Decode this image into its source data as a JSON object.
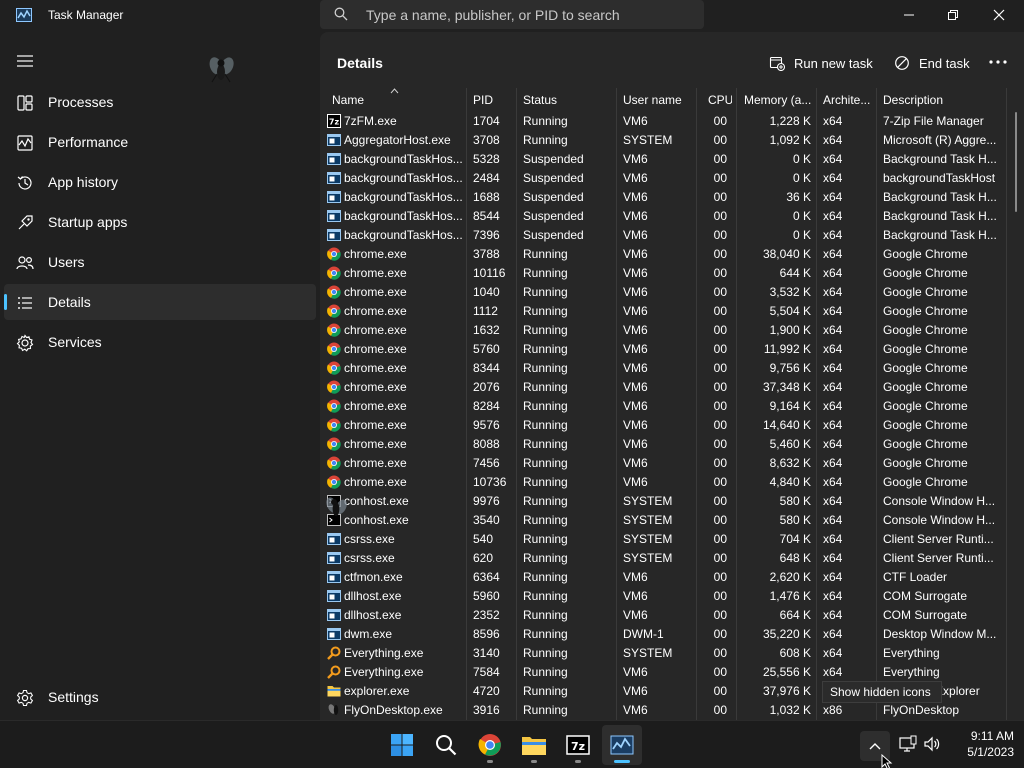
{
  "window": {
    "title": "Task Manager",
    "search_placeholder": "Type a name, publisher, or PID to search"
  },
  "sidebar": {
    "items": [
      {
        "label": "Processes",
        "icon": "processes-icon",
        "active": false
      },
      {
        "label": "Performance",
        "icon": "performance-icon",
        "active": false
      },
      {
        "label": "App history",
        "icon": "app-history-icon",
        "active": false
      },
      {
        "label": "Startup apps",
        "icon": "startup-apps-icon",
        "active": false
      },
      {
        "label": "Users",
        "icon": "users-icon",
        "active": false
      },
      {
        "label": "Details",
        "icon": "details-icon",
        "active": true
      },
      {
        "label": "Services",
        "icon": "services-icon",
        "active": false
      }
    ],
    "settings_label": "Settings"
  },
  "main": {
    "title": "Details",
    "run_new_task_label": "Run new task",
    "end_task_label": "End task"
  },
  "table": {
    "columns": [
      "Name",
      "PID",
      "Status",
      "User name",
      "CPU",
      "Memory (a...",
      "Archite...",
      "Description"
    ],
    "rows": [
      {
        "icon": "7zip",
        "name": "7zFM.exe",
        "pid": "1704",
        "status": "Running",
        "user": "VM6",
        "cpu": "00",
        "memory": "1,228 K",
        "arch": "x64",
        "desc": "7-Zip File Manager"
      },
      {
        "icon": "app",
        "name": "AggregatorHost.exe",
        "pid": "3708",
        "status": "Running",
        "user": "SYSTEM",
        "cpu": "00",
        "memory": "1,092 K",
        "arch": "x64",
        "desc": "Microsoft (R) Aggre..."
      },
      {
        "icon": "app",
        "name": "backgroundTaskHos...",
        "pid": "5328",
        "status": "Suspended",
        "user": "VM6",
        "cpu": "00",
        "memory": "0 K",
        "arch": "x64",
        "desc": "Background Task H..."
      },
      {
        "icon": "app",
        "name": "backgroundTaskHos...",
        "pid": "2484",
        "status": "Suspended",
        "user": "VM6",
        "cpu": "00",
        "memory": "0 K",
        "arch": "x64",
        "desc": "backgroundTaskHost"
      },
      {
        "icon": "app",
        "name": "backgroundTaskHos...",
        "pid": "1688",
        "status": "Suspended",
        "user": "VM6",
        "cpu": "00",
        "memory": "36 K",
        "arch": "x64",
        "desc": "Background Task H..."
      },
      {
        "icon": "app",
        "name": "backgroundTaskHos...",
        "pid": "8544",
        "status": "Suspended",
        "user": "VM6",
        "cpu": "00",
        "memory": "0 K",
        "arch": "x64",
        "desc": "Background Task H..."
      },
      {
        "icon": "app",
        "name": "backgroundTaskHos...",
        "pid": "7396",
        "status": "Suspended",
        "user": "VM6",
        "cpu": "00",
        "memory": "0 K",
        "arch": "x64",
        "desc": "Background Task H..."
      },
      {
        "icon": "chrome",
        "name": "chrome.exe",
        "pid": "3788",
        "status": "Running",
        "user": "VM6",
        "cpu": "00",
        "memory": "38,040 K",
        "arch": "x64",
        "desc": "Google Chrome"
      },
      {
        "icon": "chrome",
        "name": "chrome.exe",
        "pid": "10116",
        "status": "Running",
        "user": "VM6",
        "cpu": "00",
        "memory": "644 K",
        "arch": "x64",
        "desc": "Google Chrome"
      },
      {
        "icon": "chrome",
        "name": "chrome.exe",
        "pid": "1040",
        "status": "Running",
        "user": "VM6",
        "cpu": "00",
        "memory": "3,532 K",
        "arch": "x64",
        "desc": "Google Chrome"
      },
      {
        "icon": "chrome",
        "name": "chrome.exe",
        "pid": "1112",
        "status": "Running",
        "user": "VM6",
        "cpu": "00",
        "memory": "5,504 K",
        "arch": "x64",
        "desc": "Google Chrome"
      },
      {
        "icon": "chrome",
        "name": "chrome.exe",
        "pid": "1632",
        "status": "Running",
        "user": "VM6",
        "cpu": "00",
        "memory": "1,900 K",
        "arch": "x64",
        "desc": "Google Chrome"
      },
      {
        "icon": "chrome",
        "name": "chrome.exe",
        "pid": "5760",
        "status": "Running",
        "user": "VM6",
        "cpu": "00",
        "memory": "11,992 K",
        "arch": "x64",
        "desc": "Google Chrome"
      },
      {
        "icon": "chrome",
        "name": "chrome.exe",
        "pid": "8344",
        "status": "Running",
        "user": "VM6",
        "cpu": "00",
        "memory": "9,756 K",
        "arch": "x64",
        "desc": "Google Chrome"
      },
      {
        "icon": "chrome",
        "name": "chrome.exe",
        "pid": "2076",
        "status": "Running",
        "user": "VM6",
        "cpu": "00",
        "memory": "37,348 K",
        "arch": "x64",
        "desc": "Google Chrome"
      },
      {
        "icon": "chrome",
        "name": "chrome.exe",
        "pid": "8284",
        "status": "Running",
        "user": "VM6",
        "cpu": "00",
        "memory": "9,164 K",
        "arch": "x64",
        "desc": "Google Chrome"
      },
      {
        "icon": "chrome",
        "name": "chrome.exe",
        "pid": "9576",
        "status": "Running",
        "user": "VM6",
        "cpu": "00",
        "memory": "14,640 K",
        "arch": "x64",
        "desc": "Google Chrome"
      },
      {
        "icon": "chrome",
        "name": "chrome.exe",
        "pid": "8088",
        "status": "Running",
        "user": "VM6",
        "cpu": "00",
        "memory": "5,460 K",
        "arch": "x64",
        "desc": "Google Chrome"
      },
      {
        "icon": "chrome",
        "name": "chrome.exe",
        "pid": "7456",
        "status": "Running",
        "user": "VM6",
        "cpu": "00",
        "memory": "8,632 K",
        "arch": "x64",
        "desc": "Google Chrome"
      },
      {
        "icon": "chrome",
        "name": "chrome.exe",
        "pid": "10736",
        "status": "Running",
        "user": "VM6",
        "cpu": "00",
        "memory": "4,840 K",
        "arch": "x64",
        "desc": "Google Chrome"
      },
      {
        "icon": "console",
        "name": "conhost.exe",
        "pid": "9976",
        "status": "Running",
        "user": "SYSTEM",
        "cpu": "00",
        "memory": "580 K",
        "arch": "x64",
        "desc": "Console Window H..."
      },
      {
        "icon": "console",
        "name": "conhost.exe",
        "pid": "3540",
        "status": "Running",
        "user": "SYSTEM",
        "cpu": "00",
        "memory": "580 K",
        "arch": "x64",
        "desc": "Console Window H..."
      },
      {
        "icon": "app",
        "name": "csrss.exe",
        "pid": "540",
        "status": "Running",
        "user": "SYSTEM",
        "cpu": "00",
        "memory": "704 K",
        "arch": "x64",
        "desc": "Client Server Runti..."
      },
      {
        "icon": "app",
        "name": "csrss.exe",
        "pid": "620",
        "status": "Running",
        "user": "SYSTEM",
        "cpu": "00",
        "memory": "648 K",
        "arch": "x64",
        "desc": "Client Server Runti..."
      },
      {
        "icon": "app",
        "name": "ctfmon.exe",
        "pid": "6364",
        "status": "Running",
        "user": "VM6",
        "cpu": "00",
        "memory": "2,620 K",
        "arch": "x64",
        "desc": "CTF Loader"
      },
      {
        "icon": "app",
        "name": "dllhost.exe",
        "pid": "5960",
        "status": "Running",
        "user": "VM6",
        "cpu": "00",
        "memory": "1,476 K",
        "arch": "x64",
        "desc": "COM Surrogate"
      },
      {
        "icon": "app",
        "name": "dllhost.exe",
        "pid": "2352",
        "status": "Running",
        "user": "VM6",
        "cpu": "00",
        "memory": "664 K",
        "arch": "x64",
        "desc": "COM Surrogate"
      },
      {
        "icon": "app",
        "name": "dwm.exe",
        "pid": "8596",
        "status": "Running",
        "user": "DWM-1",
        "cpu": "00",
        "memory": "35,220 K",
        "arch": "x64",
        "desc": "Desktop Window M..."
      },
      {
        "icon": "everything",
        "name": "Everything.exe",
        "pid": "3140",
        "status": "Running",
        "user": "SYSTEM",
        "cpu": "00",
        "memory": "608 K",
        "arch": "x64",
        "desc": "Everything"
      },
      {
        "icon": "everything",
        "name": "Everything.exe",
        "pid": "7584",
        "status": "Running",
        "user": "VM6",
        "cpu": "00",
        "memory": "25,556 K",
        "arch": "x64",
        "desc": "Everything"
      },
      {
        "icon": "explorer",
        "name": "explorer.exe",
        "pid": "4720",
        "status": "Running",
        "user": "VM6",
        "cpu": "00",
        "memory": "37,976 K",
        "arch": "x64",
        "desc": "Windows Explorer"
      },
      {
        "icon": "fly",
        "name": "FlyOnDesktop.exe",
        "pid": "3916",
        "status": "Running",
        "user": "VM6",
        "cpu": "00",
        "memory": "1,032 K",
        "arch": "x86",
        "desc": "FlyOnDesktop"
      }
    ]
  },
  "tooltip": "Show hidden icons",
  "taskbar": {
    "apps": [
      "start-icon",
      "search-icon",
      "chrome-icon",
      "file-explorer-icon",
      "7zip-icon",
      "task-manager-icon"
    ],
    "time": "9:11 AM",
    "date": "5/1/2023"
  },
  "colors": {
    "accent": "#4cc2ff",
    "background": "#202020",
    "panel": "#272727"
  }
}
